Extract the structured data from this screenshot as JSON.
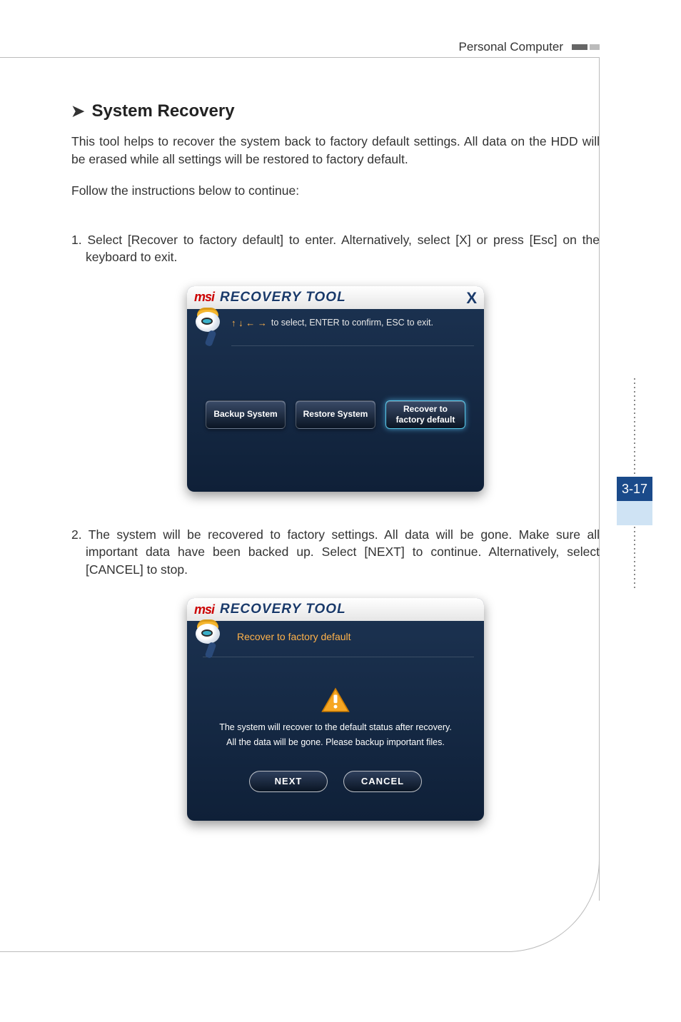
{
  "header": {
    "product": "Personal Computer"
  },
  "page_number": "3-17",
  "section": {
    "title": "System Recovery",
    "intro": "This tool helps to recover the system back to factory default settings. All data on the HDD will be erased while all settings will be restored to factory default.",
    "follow": "Follow the instructions below to continue:"
  },
  "steps": {
    "s1": "1. Select [Recover to factory default] to enter. Alternatively, select [X] or press [Esc] on the keyboard to exit.",
    "s2": "2. The system will be recovered to factory settings. All data will be gone. Make sure all important data have been backed up. Select [NEXT] to continue. Alternatively, select [CANCEL] to stop."
  },
  "tool": {
    "brand": "msi",
    "title": "RECOVERY TOOL",
    "close": "X",
    "nav_arrows": "↑ ↓ ← →",
    "nav_hint": "to select, ENTER to confirm, ESC to exit.",
    "buttons": {
      "backup": "Backup System",
      "restore": "Restore System",
      "recover": "Recover to factory default"
    }
  },
  "confirm": {
    "subtitle": "Recover to factory default",
    "msg1": "The system will recover to the default status after recovery.",
    "msg2": "All the data will be gone. Please backup important files.",
    "next": "NEXT",
    "cancel": "CANCEL"
  }
}
